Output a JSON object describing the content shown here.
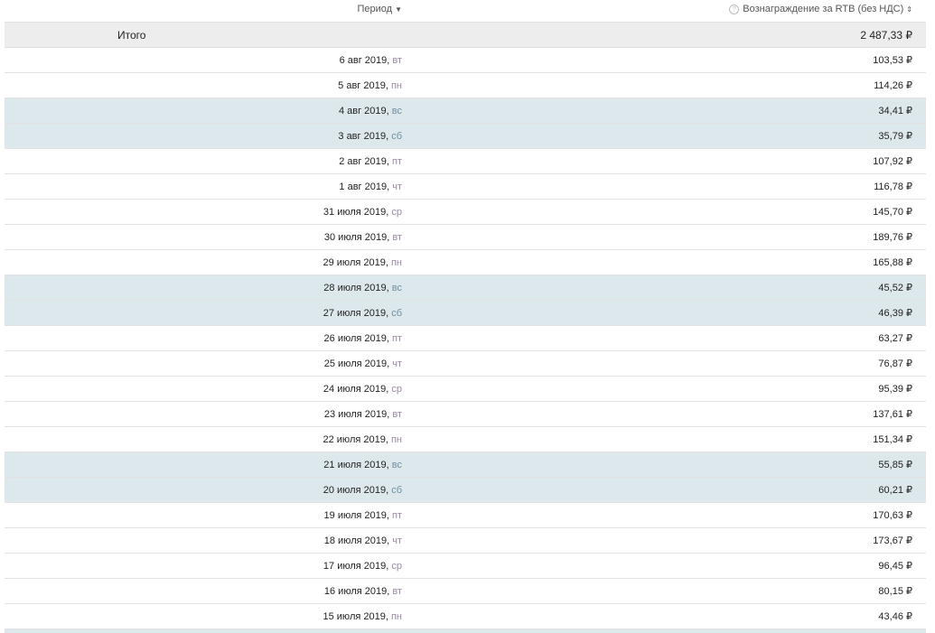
{
  "header": {
    "period_label": "Период",
    "period_sort_icon": "▼",
    "reward_label": "Вознаграждение за RTB (без НДС)",
    "reward_sort_icon": "⇕",
    "help_icon": "?"
  },
  "total": {
    "label": "Итого",
    "value": "2 487,33 ₽"
  },
  "rows": [
    {
      "date": "6 авг 2019,",
      "wd": "вт",
      "value": "103,53 ₽",
      "weekend": false
    },
    {
      "date": "5 авг 2019,",
      "wd": "пн",
      "value": "114,26 ₽",
      "weekend": false
    },
    {
      "date": "4 авг 2019,",
      "wd": "вс",
      "value": "34,41 ₽",
      "weekend": true
    },
    {
      "date": "3 авг 2019,",
      "wd": "сб",
      "value": "35,79 ₽",
      "weekend": true
    },
    {
      "date": "2 авг 2019,",
      "wd": "пт",
      "value": "107,92 ₽",
      "weekend": false
    },
    {
      "date": "1 авг 2019,",
      "wd": "чт",
      "value": "116,78 ₽",
      "weekend": false
    },
    {
      "date": "31 июля 2019,",
      "wd": "ср",
      "value": "145,70 ₽",
      "weekend": false
    },
    {
      "date": "30 июля 2019,",
      "wd": "вт",
      "value": "189,76 ₽",
      "weekend": false
    },
    {
      "date": "29 июля 2019,",
      "wd": "пн",
      "value": "165,88 ₽",
      "weekend": false
    },
    {
      "date": "28 июля 2019,",
      "wd": "вс",
      "value": "45,52 ₽",
      "weekend": true
    },
    {
      "date": "27 июля 2019,",
      "wd": "сб",
      "value": "46,39 ₽",
      "weekend": true
    },
    {
      "date": "26 июля 2019,",
      "wd": "пт",
      "value": "63,27 ₽",
      "weekend": false
    },
    {
      "date": "25 июля 2019,",
      "wd": "чт",
      "value": "76,87 ₽",
      "weekend": false
    },
    {
      "date": "24 июля 2019,",
      "wd": "ср",
      "value": "95,39 ₽",
      "weekend": false
    },
    {
      "date": "23 июля 2019,",
      "wd": "вт",
      "value": "137,61 ₽",
      "weekend": false
    },
    {
      "date": "22 июля 2019,",
      "wd": "пн",
      "value": "151,34 ₽",
      "weekend": false
    },
    {
      "date": "21 июля 2019,",
      "wd": "вс",
      "value": "55,85 ₽",
      "weekend": true
    },
    {
      "date": "20 июля 2019,",
      "wd": "сб",
      "value": "60,21 ₽",
      "weekend": true
    },
    {
      "date": "19 июля 2019,",
      "wd": "пт",
      "value": "170,63 ₽",
      "weekend": false
    },
    {
      "date": "18 июля 2019,",
      "wd": "чт",
      "value": "173,67 ₽",
      "weekend": false
    },
    {
      "date": "17 июля 2019,",
      "wd": "ср",
      "value": "96,45 ₽",
      "weekend": false
    },
    {
      "date": "16 июля 2019,",
      "wd": "вт",
      "value": "80,15 ₽",
      "weekend": false
    },
    {
      "date": "15 июля 2019,",
      "wd": "пн",
      "value": "43,46 ₽",
      "weekend": false
    }
  ]
}
